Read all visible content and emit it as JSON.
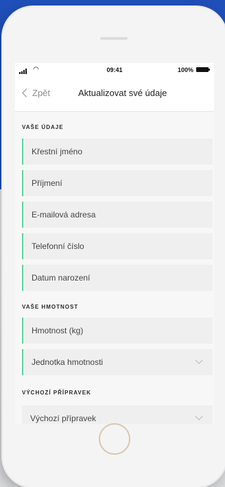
{
  "status": {
    "time": "09:41",
    "battery": "100%"
  },
  "nav": {
    "back_label": "Zpět",
    "title": "Aktualizovat své údaje"
  },
  "sections": {
    "personal": {
      "header": "VAŠE ÚDAJE",
      "fields": [
        "Křestní jméno",
        "Příjmení",
        "E-mailová adresa",
        "Telefonní číslo",
        "Datum narození"
      ]
    },
    "weight": {
      "header": "VAŠE HMOTNOST",
      "fields": [
        "Hmotnost (kg)",
        "Jednotka hmotnosti"
      ]
    },
    "product": {
      "header": "VÝCHOZÍ PŘÍPRAVEK",
      "fields": [
        "Výchozí přípravek"
      ]
    }
  },
  "colors": {
    "accent": "#5ad5a0",
    "background_blue": "#1f4fb8",
    "home_ring": "#d9c8ae"
  }
}
